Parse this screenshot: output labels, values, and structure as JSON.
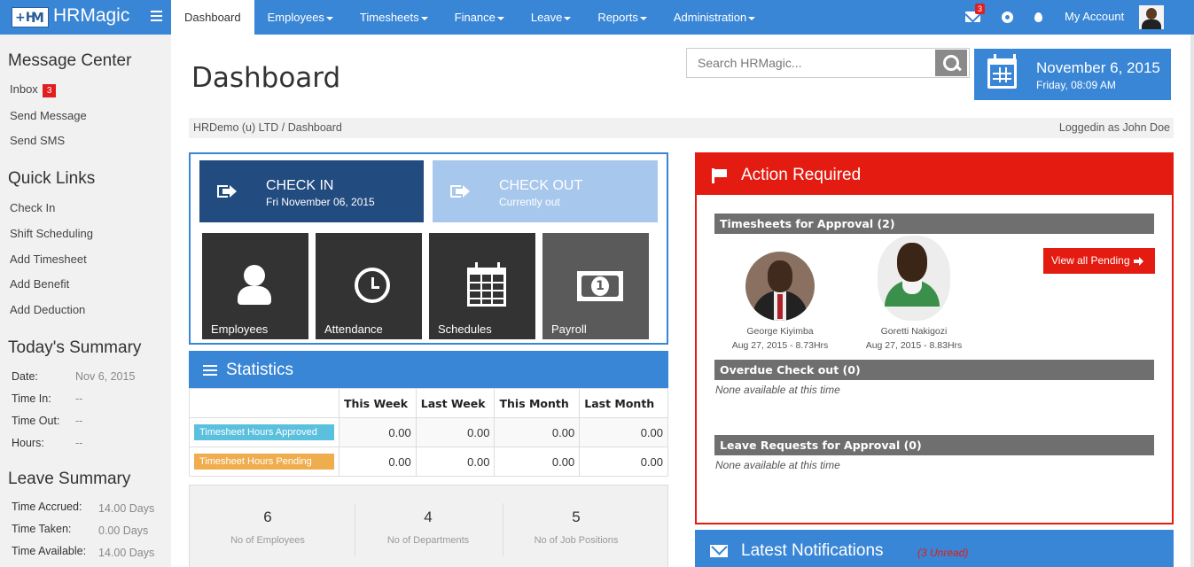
{
  "brand": {
    "logo_left": "+H",
    "logo_right": "M",
    "name": "HRMagic"
  },
  "nav": {
    "items": [
      {
        "label": "Dashboard",
        "active": true,
        "caret": false
      },
      {
        "label": "Employees",
        "active": false,
        "caret": true
      },
      {
        "label": "Timesheets",
        "active": false,
        "caret": true
      },
      {
        "label": "Finance",
        "active": false,
        "caret": true
      },
      {
        "label": "Leave",
        "active": false,
        "caret": true
      },
      {
        "label": "Reports",
        "active": false,
        "caret": true
      },
      {
        "label": "Administration",
        "active": false,
        "caret": true
      }
    ],
    "mail_count": "3",
    "account_label": "My Account"
  },
  "sidebar": {
    "message_center": {
      "title": "Message Center",
      "inbox_label": "Inbox",
      "inbox_count": "3",
      "send_message": "Send Message",
      "send_sms": "Send SMS"
    },
    "quick_links": {
      "title": "Quick Links",
      "items": [
        "Check In",
        "Shift Scheduling",
        "Add Timesheet",
        "Add Benefit",
        "Add Deduction"
      ]
    },
    "todays_summary": {
      "title": "Today's Summary",
      "rows": [
        {
          "label": "Date:",
          "value": "Nov 6, 2015"
        },
        {
          "label": "Time In:",
          "value": "--"
        },
        {
          "label": "Time Out:",
          "value": "--"
        },
        {
          "label": "Hours:",
          "value": "--"
        }
      ]
    },
    "leave_summary": {
      "title": "Leave Summary",
      "rows": [
        {
          "label": "Time Accrued:",
          "value": "14.00 Days"
        },
        {
          "label": "Time Taken:",
          "value": "0.00 Days"
        },
        {
          "label": "Time Available:",
          "value": "14.00 Days"
        }
      ]
    }
  },
  "main": {
    "title": "Dashboard",
    "search_placeholder": "Search HRMagic...",
    "date": {
      "main": "November 6, 2015",
      "sub": "Friday, 08:09 AM"
    },
    "breadcrumb": "HRDemo (u) LTD / Dashboard",
    "logged_in": "Loggedin as John Doe"
  },
  "check": {
    "in": {
      "title": "CHECK IN",
      "sub": "Fri November 06, 2015"
    },
    "out": {
      "title": "CHECK OUT",
      "sub": "Currently out"
    },
    "tiles": [
      "Employees",
      "Attendance",
      "Schedules",
      "Payroll"
    ]
  },
  "statistics": {
    "title": "Statistics",
    "columns": [
      "This Week",
      "Last Week",
      "This Month",
      "Last Month"
    ],
    "rows": [
      {
        "label": "Timesheet Hours Approved",
        "values": [
          "0.00",
          "0.00",
          "0.00",
          "0.00"
        ]
      },
      {
        "label": "Timesheet Hours Pending",
        "values": [
          "0.00",
          "0.00",
          "0.00",
          "0.00"
        ]
      }
    ],
    "counts": [
      {
        "value": "6",
        "label": "No of Employees"
      },
      {
        "value": "4",
        "label": "No of Departments"
      },
      {
        "value": "5",
        "label": "No of Job Positions"
      }
    ]
  },
  "action": {
    "title": "Action Required",
    "timesheets_title": "Timesheets for Approval (2)",
    "people": [
      {
        "name": "George Kiyimba",
        "detail": "Aug 27, 2015 - 8.73Hrs"
      },
      {
        "name": "Goretti Nakigozi",
        "detail": "Aug 27, 2015 - 8.83Hrs"
      }
    ],
    "view_pending": "View all Pending",
    "overdue_title": "Overdue Check out (0)",
    "overdue_empty": "None available at this time",
    "leave_title": "Leave Requests for Approval (0)",
    "leave_empty": "None available at this time"
  },
  "notifications": {
    "title": "Latest Notifications",
    "unread": "(3 Unread)"
  }
}
